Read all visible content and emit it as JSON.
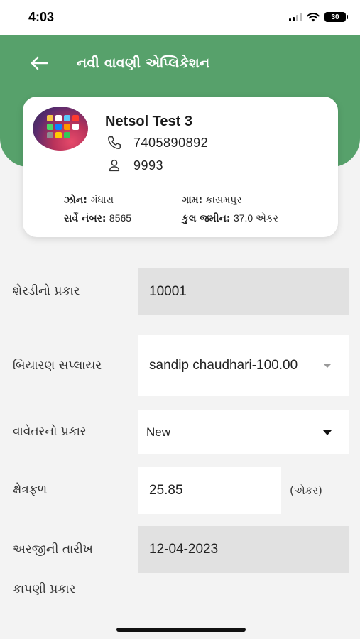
{
  "status": {
    "time": "4:03",
    "battery": "30"
  },
  "header": {
    "title": "નવી વાવણી એપ્લિકેશન"
  },
  "profile": {
    "name": "Netsol Test 3",
    "phone": "7405890892",
    "id": "9993",
    "zone_label": "ઝોન:",
    "zone_value": "ગંધારા",
    "village_label": "ગામ:",
    "village_value": "કાસમપુર",
    "survey_label": "સર્વે નંબર:",
    "survey_value": "8565",
    "land_label": "કુલ જમીન:",
    "land_value": "37.0 એકર"
  },
  "form": {
    "cane_type": {
      "label": "શેરડીનો પ્રકાર",
      "value": "10001"
    },
    "seed_supplier": {
      "label": "બિયારણ સપ્લાયર",
      "value": "sandip chaudhari-100.00"
    },
    "planting_type": {
      "label": "વાવેતરનો પ્રકાર",
      "value": "New"
    },
    "area": {
      "label": "ક્ષેત્રફળ",
      "value": "25.85",
      "unit": "(એકર)"
    },
    "application_date": {
      "label": "અરજીની તારીખ",
      "value": "12-04-2023"
    },
    "harvest_type": {
      "label": "કાપણી પ્રકાર"
    }
  },
  "colors": {
    "header": "#57a16b",
    "disabled_field": "#e1e1e1"
  }
}
